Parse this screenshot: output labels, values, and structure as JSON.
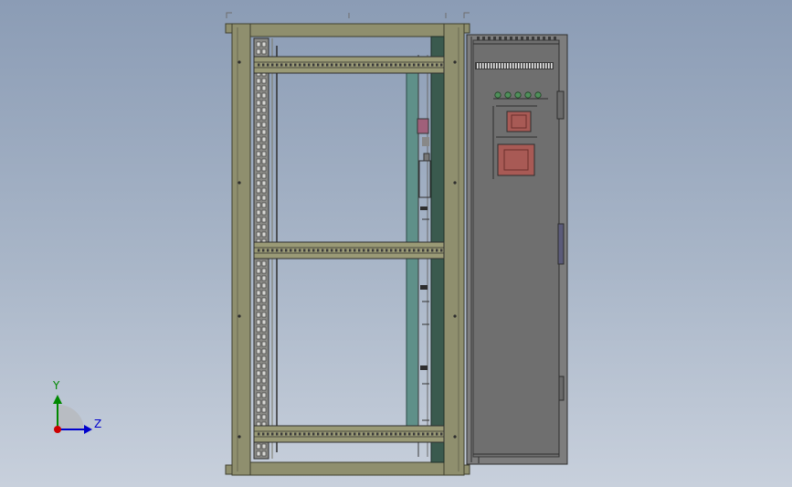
{
  "viewport": {
    "background_top": "#8b9cb5",
    "background_bottom": "#c8d0dc"
  },
  "colors": {
    "frame": "#8f8f6e",
    "frame_dark": "#3f3f2e",
    "rail": "#9a9a76",
    "door_panel": "#6f6f6f",
    "door_frame": "#7d7d7d",
    "teal_post": "#5f9089",
    "dark_post": "#3a5a4e",
    "relay_red": "#a85a55",
    "terminal_green": "#4f8f5a",
    "axis_x": "#cc0000",
    "axis_y": "#008800",
    "axis_z": "#0000cc"
  },
  "triad": {
    "y_label": "Y",
    "z_label": "Z"
  },
  "icons": {
    "triad": "coordinate-triad-icon",
    "origin": "origin-dot-icon"
  }
}
